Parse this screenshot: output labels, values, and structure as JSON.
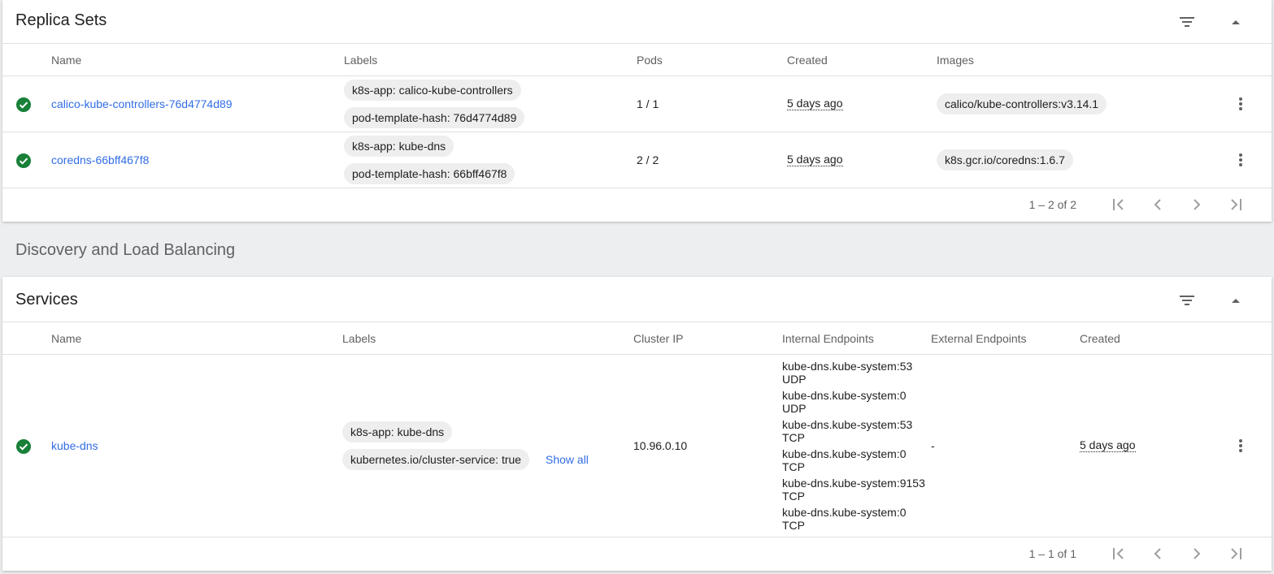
{
  "replica_sets": {
    "title": "Replica Sets",
    "columns": [
      "Name",
      "Labels",
      "Pods",
      "Created",
      "Images"
    ],
    "rows": [
      {
        "name": "calico-kube-controllers-76d4774d89",
        "labels": [
          "k8s-app: calico-kube-controllers",
          "pod-template-hash: 76d4774d89"
        ],
        "pods": "1 / 1",
        "created": "5 days ago",
        "image": "calico/kube-controllers:v3.14.1"
      },
      {
        "name": "coredns-66bff467f8",
        "labels": [
          "k8s-app: kube-dns",
          "pod-template-hash: 66bff467f8"
        ],
        "pods": "2 / 2",
        "created": "5 days ago",
        "image": "k8s.gcr.io/coredns:1.6.7"
      }
    ],
    "pagination": "1 – 2 of 2"
  },
  "discovery_section_title": "Discovery and Load Balancing",
  "services": {
    "title": "Services",
    "columns": [
      "Name",
      "Labels",
      "Cluster IP",
      "Internal Endpoints",
      "External Endpoints",
      "Created"
    ],
    "rows": [
      {
        "name": "kube-dns",
        "labels": [
          "k8s-app: kube-dns",
          "kubernetes.io/cluster-service: true"
        ],
        "show_all": "Show all",
        "cluster_ip": "10.96.0.10",
        "internal_endpoints": [
          [
            "kube-dns.kube-system:53",
            "UDP"
          ],
          [
            "kube-dns.kube-system:0",
            "UDP"
          ],
          [
            "kube-dns.kube-system:53",
            "TCP"
          ],
          [
            "kube-dns.kube-system:0",
            "TCP"
          ],
          [
            "kube-dns.kube-system:9153",
            "TCP"
          ],
          [
            "kube-dns.kube-system:0",
            "TCP"
          ]
        ],
        "external_endpoints": "-",
        "created": "5 days ago"
      }
    ],
    "pagination": "1 – 1 of 1"
  },
  "icons": {
    "filter": "filter-icon",
    "collapse": "chevron-up-icon",
    "status_ok": "check-circle-icon",
    "menu": "more-vert-icon",
    "first_page": "first-page-icon",
    "prev_page": "chevron-left-icon",
    "next_page": "chevron-right-icon",
    "last_page": "last-page-icon"
  },
  "colors": {
    "status_ok": "#188038",
    "link": "#326de6",
    "background": "#edeef0"
  }
}
